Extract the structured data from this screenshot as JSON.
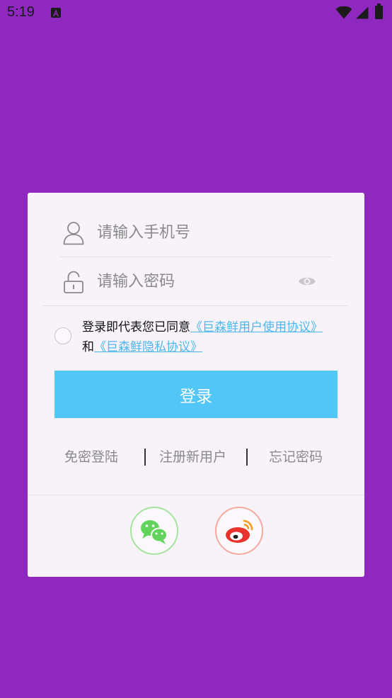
{
  "status_bar": {
    "time": "5:19",
    "icons": [
      "app-notification-icon",
      "wifi-icon",
      "cell-signal-icon",
      "battery-icon"
    ]
  },
  "login": {
    "phone_placeholder": "请输入手机号",
    "password_placeholder": "请输入密码",
    "agreement": {
      "prefix": "登录即代表您已同意",
      "user_agreement": "《巨森鲜用户使用协议》",
      "joiner": "和",
      "privacy_policy": "《巨森鲜隐私协议》"
    },
    "login_button": "登录",
    "links": {
      "free_login": "免密登陆",
      "register": "注册新用户",
      "forgot_password": "忘记密码"
    },
    "social": [
      "wechat-icon",
      "weibo-icon"
    ]
  },
  "colors": {
    "background": "#8e28bf",
    "card": "#f7f3f9",
    "primary_button": "#52c6f6",
    "link": "#4db6ef",
    "wechat": "#62d45c",
    "weibo": "#e9322d"
  }
}
